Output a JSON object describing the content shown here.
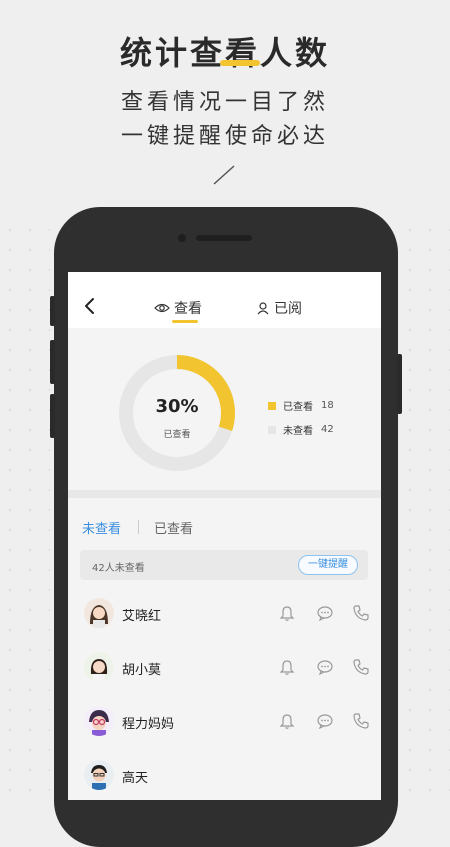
{
  "promo": {
    "headline": "统计查看人数",
    "line1": "查看情况一目了然",
    "line2": "一键提醒使命必达"
  },
  "app": {
    "nav": {
      "back_icon": "chevron-left-icon",
      "tabs": [
        {
          "label": "查看",
          "icon": "eye-icon",
          "active": true
        },
        {
          "label": "已阅",
          "icon": "user-icon",
          "active": false
        }
      ]
    },
    "stats": {
      "percent_text": "30%",
      "percent_value": 0.3,
      "center_label": "已查看",
      "legend": [
        {
          "label": "已查看",
          "count": "18",
          "color": "#f2c530"
        },
        {
          "label": "未查看",
          "count": "42",
          "color": "#e6e6e6"
        }
      ]
    },
    "filters": [
      {
        "label": "未查看",
        "active": true
      },
      {
        "label": "已查看",
        "active": false
      }
    ],
    "notice": {
      "text": "42人未查看",
      "button": "一键提醒"
    },
    "members": [
      {
        "name": "艾晓红"
      },
      {
        "name": "胡小莫"
      },
      {
        "name": "程力妈妈"
      },
      {
        "name": "高天"
      }
    ],
    "row_icons": [
      "bell-icon",
      "chat-icon",
      "phone-icon"
    ],
    "colors": {
      "accent": "#f2c530",
      "link": "#3a8fe0"
    }
  }
}
